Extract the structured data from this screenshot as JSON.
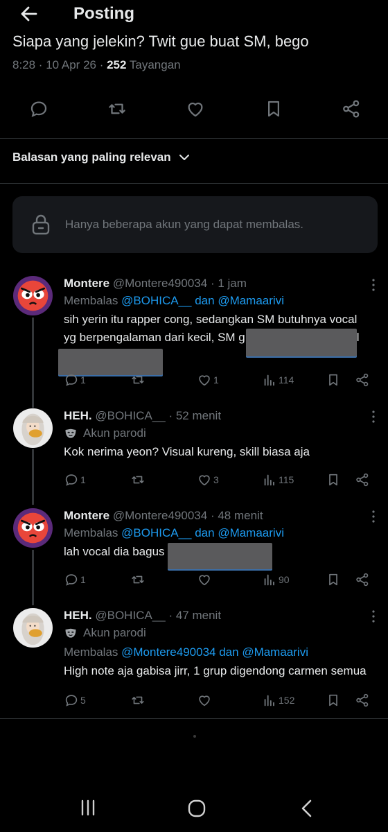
{
  "header": {
    "title": "Posting"
  },
  "post": {
    "text_partial": "Siapa yang jelekin? Twit gue buat SM, bego",
    "time": "8:28 · 10 Apr 26 · ",
    "views": "252",
    "views_label": " Tayangan"
  },
  "sort": {
    "label": "Balasan yang paling relevan"
  },
  "restriction": {
    "text": "Hanya beberapa akun yang dapat membalas."
  },
  "replies": [
    {
      "name": "Montere",
      "handle": "@Montere490034",
      "time": "· 1 jam",
      "replying_prefix": "Membalas ",
      "mention1": "@BOHICA__",
      "mid": " dan ",
      "mention2": "@Mamaarivi",
      "line1": "sih yerin itu rapper cong, sedangkan SM butuhnya vocal",
      "line2": "yg berpengalaman dari kecil, SM g",
      "line2_tail": "l",
      "replies": "1",
      "reposts": "",
      "likes": "1",
      "views": "114"
    },
    {
      "name": "HEH.",
      "handle": "@BOHICA__",
      "time": "· 52 menit",
      "parody": "Akun parodi",
      "line1": "Kok nerima yeon? Visual kureng, skill biasa aja",
      "replies": "1",
      "reposts": "",
      "likes": "3",
      "views": "115"
    },
    {
      "name": "Montere",
      "handle": "@Montere490034",
      "time": "· 48 menit",
      "replying_prefix": "Membalas ",
      "mention1": "@BOHICA__",
      "mid": " dan ",
      "mention2": "@Mamaarivi",
      "line1": "lah vocal dia bagus",
      "replies": "1",
      "reposts": "",
      "likes": "",
      "views": "90"
    },
    {
      "name": "HEH.",
      "handle": "@BOHICA__",
      "time": "· 47 menit",
      "parody": "Akun parodi",
      "replying_prefix": "Membalas ",
      "mention1": "@Montere490034",
      "mid": " dan ",
      "mention2": "@Mamaarivi",
      "line1": "High note aja gabisa jirr, 1 grup digendong carmen semua",
      "replies": "5",
      "reposts": "",
      "likes": "",
      "views": "152"
    }
  ],
  "colors": {
    "background": "#000000",
    "accent": "#1d9bf0",
    "muted": "#71767b",
    "text": "#e7e9ea"
  }
}
